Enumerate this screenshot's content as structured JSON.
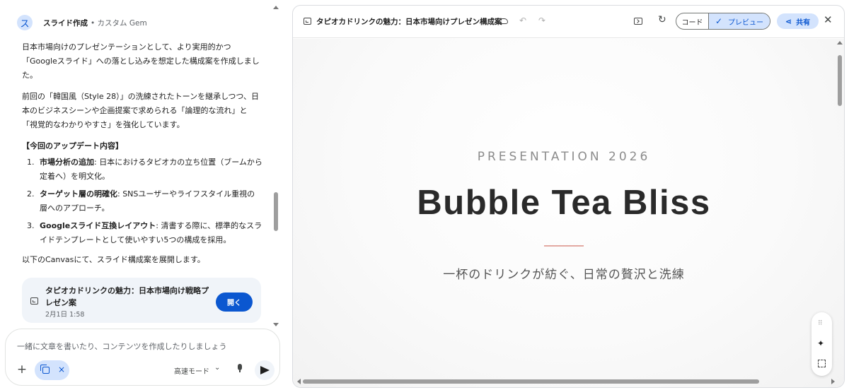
{
  "chat": {
    "gem_initial": "ス",
    "gem_name": "スライド作成",
    "gem_sub": "• カスタム Gem",
    "paragraphs": [
      "日本市場向けのプレゼンテーションとして、より実用的かつ「Googleスライド」への落とし込みを想定した構成案を作成しました。",
      "前回の「韓国風（Style 28）」の洗練されたトーンを継承しつつ、日本のビジネスシーンや企画提案で求められる「論理的な流れ」と「視覚的なわかりやすさ」を強化しています。"
    ],
    "section_title": "【今回のアップデート内容】",
    "updates": [
      {
        "num": "1.",
        "bold": "市場分析の追加",
        "text": ": 日本におけるタピオカの立ち位置（ブームから定着へ）を明文化。"
      },
      {
        "num": "2.",
        "bold": "ターゲット層の明確化",
        "text": ": SNSユーザーやライフスタイル重視の層へのアプローチ。"
      },
      {
        "num": "3.",
        "bold": "Googleスライド互換レイアウト",
        "text": ": 清書する際に、標準的なスライドテンプレートとして使いやすい5つの構成を採用。"
      }
    ],
    "closing": "以下のCanvasにて、スライド構成案を展開します。",
    "doc_card": {
      "title": "タピオカドリンクの魅力：日本市場向け戦略プレゼン案",
      "date": "2月1日 1:58",
      "open_label": "開く"
    },
    "input": {
      "placeholder": "一緒に文章を書いたり、コンテンツを作成したりしましょう",
      "plus": "+",
      "chip_close": "×",
      "mode": "高速モード",
      "mode_chevron": "⌄"
    }
  },
  "canvas": {
    "title": "タピオカドリンクの魅力：日本市場向けプレゼン構成案",
    "undo": "↶",
    "redo": "↷",
    "refresh": "↻",
    "code_label": "コード",
    "preview_check": "✓",
    "preview_label": "プレビュー",
    "share_icon": "⋖",
    "share_label": "共有",
    "close": "✕",
    "slide": {
      "kicker": "PRESENTATION 2026",
      "title": "Bubble Tea Bliss",
      "subtitle": "一杯のドリンクが紡ぐ、日常の贅沢と洗練"
    },
    "tools": {
      "dots": "⠿",
      "sparkle": "✦"
    }
  },
  "colors": {
    "accent_blue": "#0b57d0",
    "chip_blue": "#d3e3fd",
    "card_bg": "#f0f4f9",
    "rule_pink": "#e3a9a2"
  }
}
